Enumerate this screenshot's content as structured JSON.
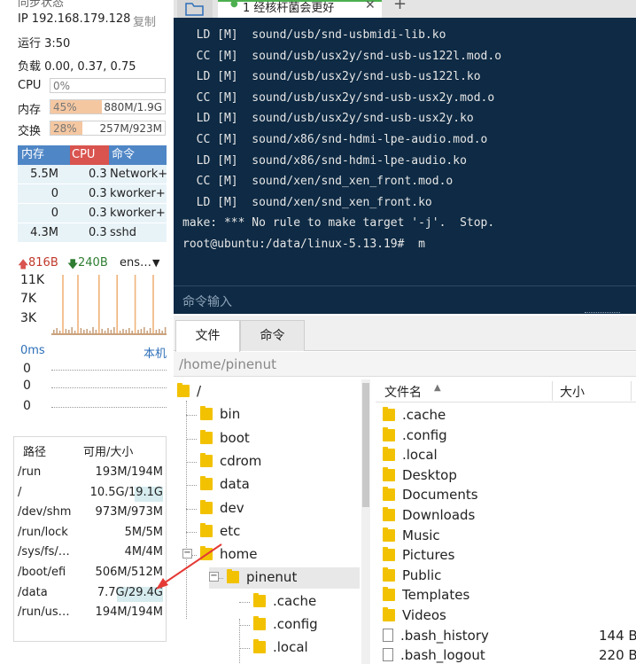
{
  "sysinfo": {
    "status_title": "同步状态",
    "ip_label": "IP 192.168.179.128",
    "copy_label": "复制",
    "uptime": "运行 3:50",
    "load": "负载 0.00, 0.37, 0.75",
    "cpu": {
      "label": "CPU",
      "percent": "0%",
      "fraction": 0.0
    },
    "mem": {
      "label": "内存",
      "percent": "45%",
      "value": "880M/1.9G",
      "fraction": 0.45
    },
    "swap": {
      "label": "交换",
      "percent": "28%",
      "value": "257M/923M",
      "fraction": 0.28
    }
  },
  "processes": {
    "headers": [
      "内存",
      "CPU",
      "命令"
    ],
    "rows": [
      {
        "mem": "5.5M",
        "cpu": "0.3",
        "cmd": "Network+"
      },
      {
        "mem": "0",
        "cpu": "0.3",
        "cmd": "kworker+"
      },
      {
        "mem": "0",
        "cpu": "0.3",
        "cmd": "kworker+"
      },
      {
        "mem": "4.3M",
        "cpu": "0.3",
        "cmd": "sshd"
      }
    ]
  },
  "network": {
    "up": "816B",
    "down": "240B",
    "iface": "ens…",
    "ticks": [
      "11K",
      "7K",
      "3K"
    ]
  },
  "latency": {
    "ms": "0ms",
    "host": "本机",
    "ticks": [
      "0",
      "0",
      "0"
    ]
  },
  "disks": {
    "headers": [
      "路径",
      "可用/大小"
    ],
    "rows": [
      {
        "path": "/run",
        "size": "193M/194M",
        "usage": 0.0
      },
      {
        "path": "/",
        "size": "10.5G/19.1G",
        "usage": 0.45
      },
      {
        "path": "/dev/shm",
        "size": "973M/973M",
        "usage": 0.0
      },
      {
        "path": "/run/lock",
        "size": "5M/5M",
        "usage": 0.0
      },
      {
        "path": "/sys/fs/…",
        "size": "4M/4M",
        "usage": 0.0
      },
      {
        "path": "/boot/efi",
        "size": "506M/512M",
        "usage": 0.0
      },
      {
        "path": "/data",
        "size": "7.7G/29.4G",
        "usage": 0.74
      },
      {
        "path": "/run/us…",
        "size": "194M/194M",
        "usage": 0.0
      }
    ]
  },
  "terminal": {
    "tab_title": "1 经核杆菌会更好",
    "lines": [
      "  LD [M]  sound/usb/snd-usbmidi-lib.ko",
      "  CC [M]  sound/usb/usx2y/snd-usb-us122l.mod.o",
      "  LD [M]  sound/usb/usx2y/snd-usb-us122l.ko",
      "  CC [M]  sound/usb/usx2y/snd-usb-usx2y.mod.o",
      "  LD [M]  sound/usb/usx2y/snd-usb-usx2y.ko",
      "  CC [M]  sound/x86/snd-hdmi-lpe-audio.mod.o",
      "  LD [M]  sound/x86/snd-hdmi-lpe-audio.ko",
      "  CC [M]  sound/xen/snd_xen_front.mod.o",
      "  LD [M]  sound/xen/snd_xen_front.ko",
      "make: *** No rule to make target '-j'.  Stop.",
      "root@ubuntu:/data/linux-5.13.19#  m"
    ],
    "input_placeholder": "命令输入"
  },
  "filemanager": {
    "tabs": [
      "文件",
      "命令"
    ],
    "path": "/home/pinenut",
    "tree": [
      "/",
      "bin",
      "boot",
      "cdrom",
      "data",
      "dev",
      "etc",
      "home",
      "pinenut",
      ".cache",
      ".config",
      ".local"
    ],
    "columns": {
      "name": "文件名",
      "size": "大小"
    },
    "entries": [
      {
        "name": ".cache",
        "type": "folder",
        "size": ""
      },
      {
        "name": ".config",
        "type": "folder",
        "size": ""
      },
      {
        "name": ".local",
        "type": "folder",
        "size": ""
      },
      {
        "name": "Desktop",
        "type": "folder",
        "size": ""
      },
      {
        "name": "Documents",
        "type": "folder",
        "size": ""
      },
      {
        "name": "Downloads",
        "type": "folder",
        "size": ""
      },
      {
        "name": "Music",
        "type": "folder",
        "size": ""
      },
      {
        "name": "Pictures",
        "type": "folder",
        "size": ""
      },
      {
        "name": "Public",
        "type": "folder",
        "size": ""
      },
      {
        "name": "Templates",
        "type": "folder",
        "size": ""
      },
      {
        "name": "Videos",
        "type": "folder",
        "size": ""
      },
      {
        "name": ".bash_history",
        "type": "file",
        "size": "144 B"
      },
      {
        "name": ".bash_logout",
        "type": "file",
        "size": "220 B"
      }
    ]
  },
  "colors": {
    "accent": "#4f86c6",
    "terminal_bg": "#0e2a44",
    "folder": "#f2c200",
    "annotation": "#e53935"
  }
}
